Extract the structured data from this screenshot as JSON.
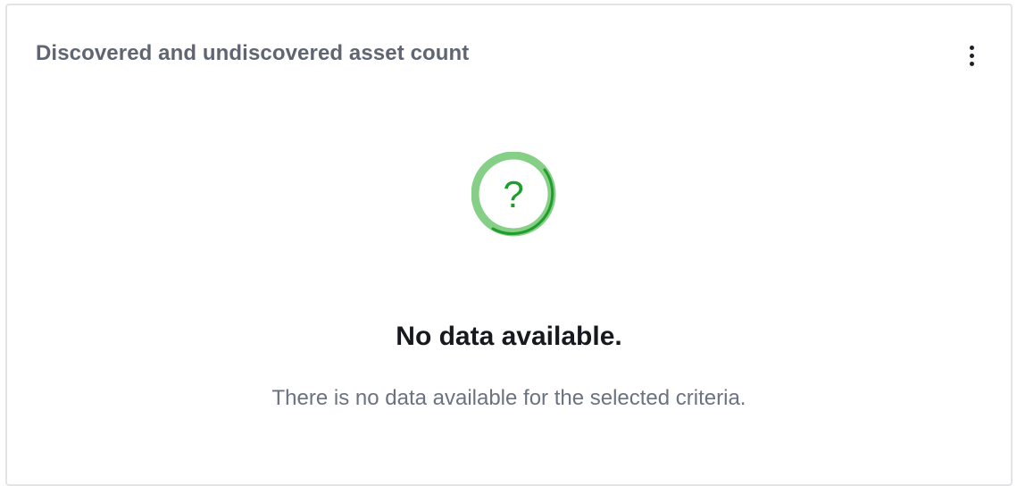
{
  "widget": {
    "title": "Discovered and undiscovered asset count",
    "menu_icon": "more-vertical-icon"
  },
  "empty_state": {
    "icon": "question-circle-icon",
    "icon_glyph": "?",
    "title": "No data available.",
    "message": "There is no data available for the selected criteria."
  },
  "colors": {
    "icon_ring_light": "#86cf86",
    "icon_ring_dark": "#1f9e2d",
    "icon_glyph": "#1f9e2d",
    "title_text": "#5f6672",
    "card_border": "#e2e4e7"
  }
}
